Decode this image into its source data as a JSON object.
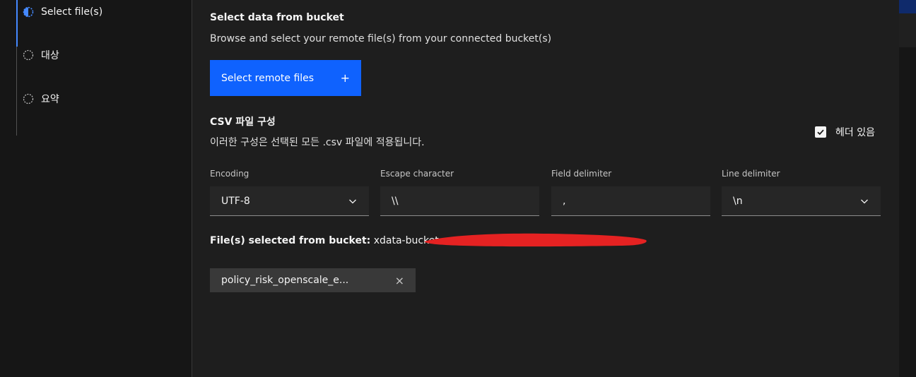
{
  "steps": [
    {
      "label": "Select file(s)",
      "state": "current"
    },
    {
      "label": "대상",
      "state": "incomplete"
    },
    {
      "label": "요약",
      "state": "incomplete"
    }
  ],
  "bucket": {
    "title": "Select data from bucket",
    "description": "Browse and select your remote file(s) from your connected bucket(s)",
    "button_label": "Select remote files",
    "button_icon": "+"
  },
  "csv": {
    "title": "CSV 파일 구성",
    "description": "이러한 구성은 선택된 모든 .csv 파일에 적용됩니다.",
    "header_checkbox_label": "헤더 있음",
    "header_checked": true
  },
  "fields": {
    "encoding": {
      "label": "Encoding",
      "value": "UTF-8"
    },
    "escape": {
      "label": "Escape character",
      "value": "\\\\"
    },
    "field_delimiter": {
      "label": "Field delimiter",
      "value": ","
    },
    "line_delimiter": {
      "label": "Line delimiter",
      "value": "\\n"
    }
  },
  "selected": {
    "prefix": "File(s) selected from bucket:",
    "bucket_name": "xdata-bucket-",
    "files": [
      {
        "name": "policy_risk_openscale_e..."
      }
    ],
    "remove_icon": "×"
  },
  "colors": {
    "primary": "#0f62fe",
    "accent": "#4589ff",
    "redaction": "#e52222"
  }
}
